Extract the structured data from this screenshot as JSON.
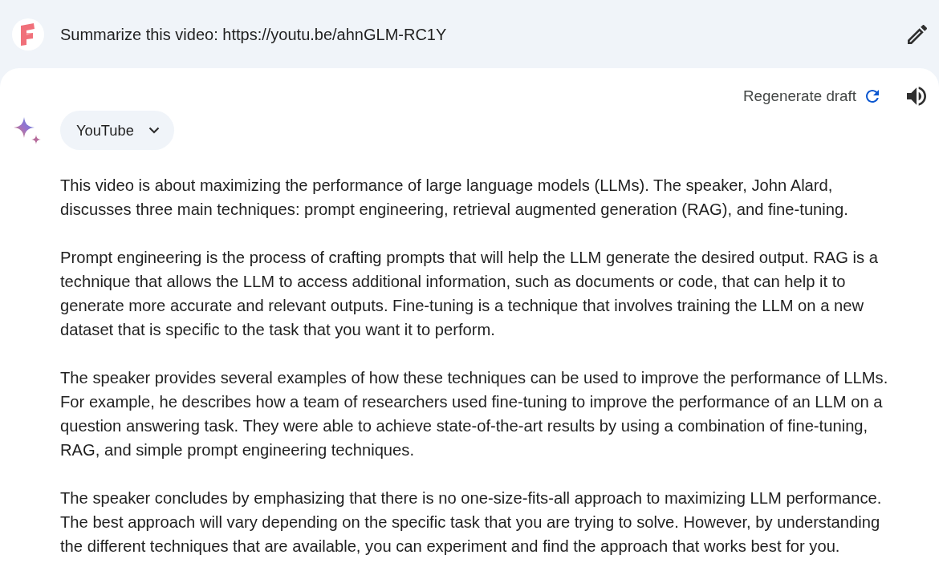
{
  "prompt": {
    "text": "Summarize this video: https://youtu.be/ahnGLM-RC1Y"
  },
  "response": {
    "regenerate": "Regenerate draft",
    "source_chip": {
      "label": "YouTube",
      "expanded": false
    },
    "paragraphs": [
      "This video is about maximizing the performance of large language models (LLMs). The speaker, John Alard, discusses three main techniques: prompt engineering, retrieval augmented generation (RAG), and fine-tuning.",
      "Prompt engineering is the process of crafting prompts that will help the LLM generate the desired output. RAG is a technique that allows the LLM to access additional information, such as documents or code, that can help it to generate more accurate and relevant outputs. Fine-tuning is a technique that involves training the LLM on a new dataset that is specific to the task that you want it to perform.",
      "The speaker provides several examples of how these techniques can be used to improve the performance of LLMs. For example, he describes how a team of researchers used fine-tuning to improve the performance of an LLM on a question answering task. They were able to achieve state-of-the-art results by using a combination of fine-tuning, RAG, and simple prompt engineering techniques.",
      "The speaker concludes by emphasizing that there is no one-size-fits-all approach to maximizing LLM performance. The best approach will vary depending on the specific task that you are trying to solve. However, by understanding the different techniques that are available, you can experiment and find the approach that works best for you."
    ]
  }
}
